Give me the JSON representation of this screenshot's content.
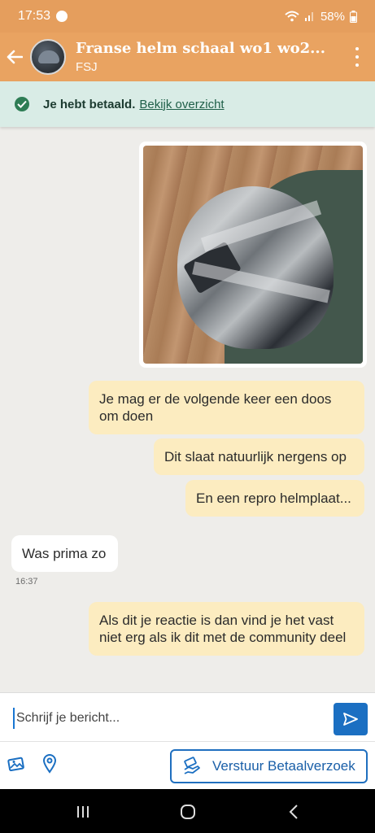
{
  "status_bar": {
    "time": "17:53",
    "battery": "58%",
    "icons": [
      "messenger-icon",
      "wifi-icon",
      "signal-icon",
      "battery-icon"
    ]
  },
  "header": {
    "title": "Franse helm schaal wo1 wo2...",
    "subtitle": "FSJ",
    "back_icon": "arrow-left-icon",
    "menu_icon": "more-vertical-icon"
  },
  "banner": {
    "text": "Je hebt betaald.",
    "link": "Bekijk overzicht",
    "icon": "check-circle-icon"
  },
  "messages": [
    {
      "type": "image",
      "direction": "out",
      "alt": "photo"
    },
    {
      "type": "text",
      "direction": "out",
      "text": "Je mag er de volgende keer een doos om doen"
    },
    {
      "type": "text",
      "direction": "out",
      "text": "Dit slaat natuurlijk nergens op"
    },
    {
      "type": "text",
      "direction": "out",
      "text": "En een repro helmplaat..."
    },
    {
      "type": "text",
      "direction": "in",
      "text": "Was prima zo",
      "time": "16:37"
    },
    {
      "type": "text",
      "direction": "out",
      "text": "Als dit je reactie is dan vind je het vast niet erg als ik dit met de community deel"
    }
  ],
  "composer": {
    "placeholder": "Schrijf je bericht..."
  },
  "actions": {
    "pay_request_label": "Verstuur Betaalverzoek"
  },
  "colors": {
    "header": "#e9a361",
    "status_bar": "#e59e5d",
    "banner": "#d9ece6",
    "out_bubble": "#fcecc0",
    "in_bubble": "#ffffff",
    "accent": "#1b6fc2"
  }
}
